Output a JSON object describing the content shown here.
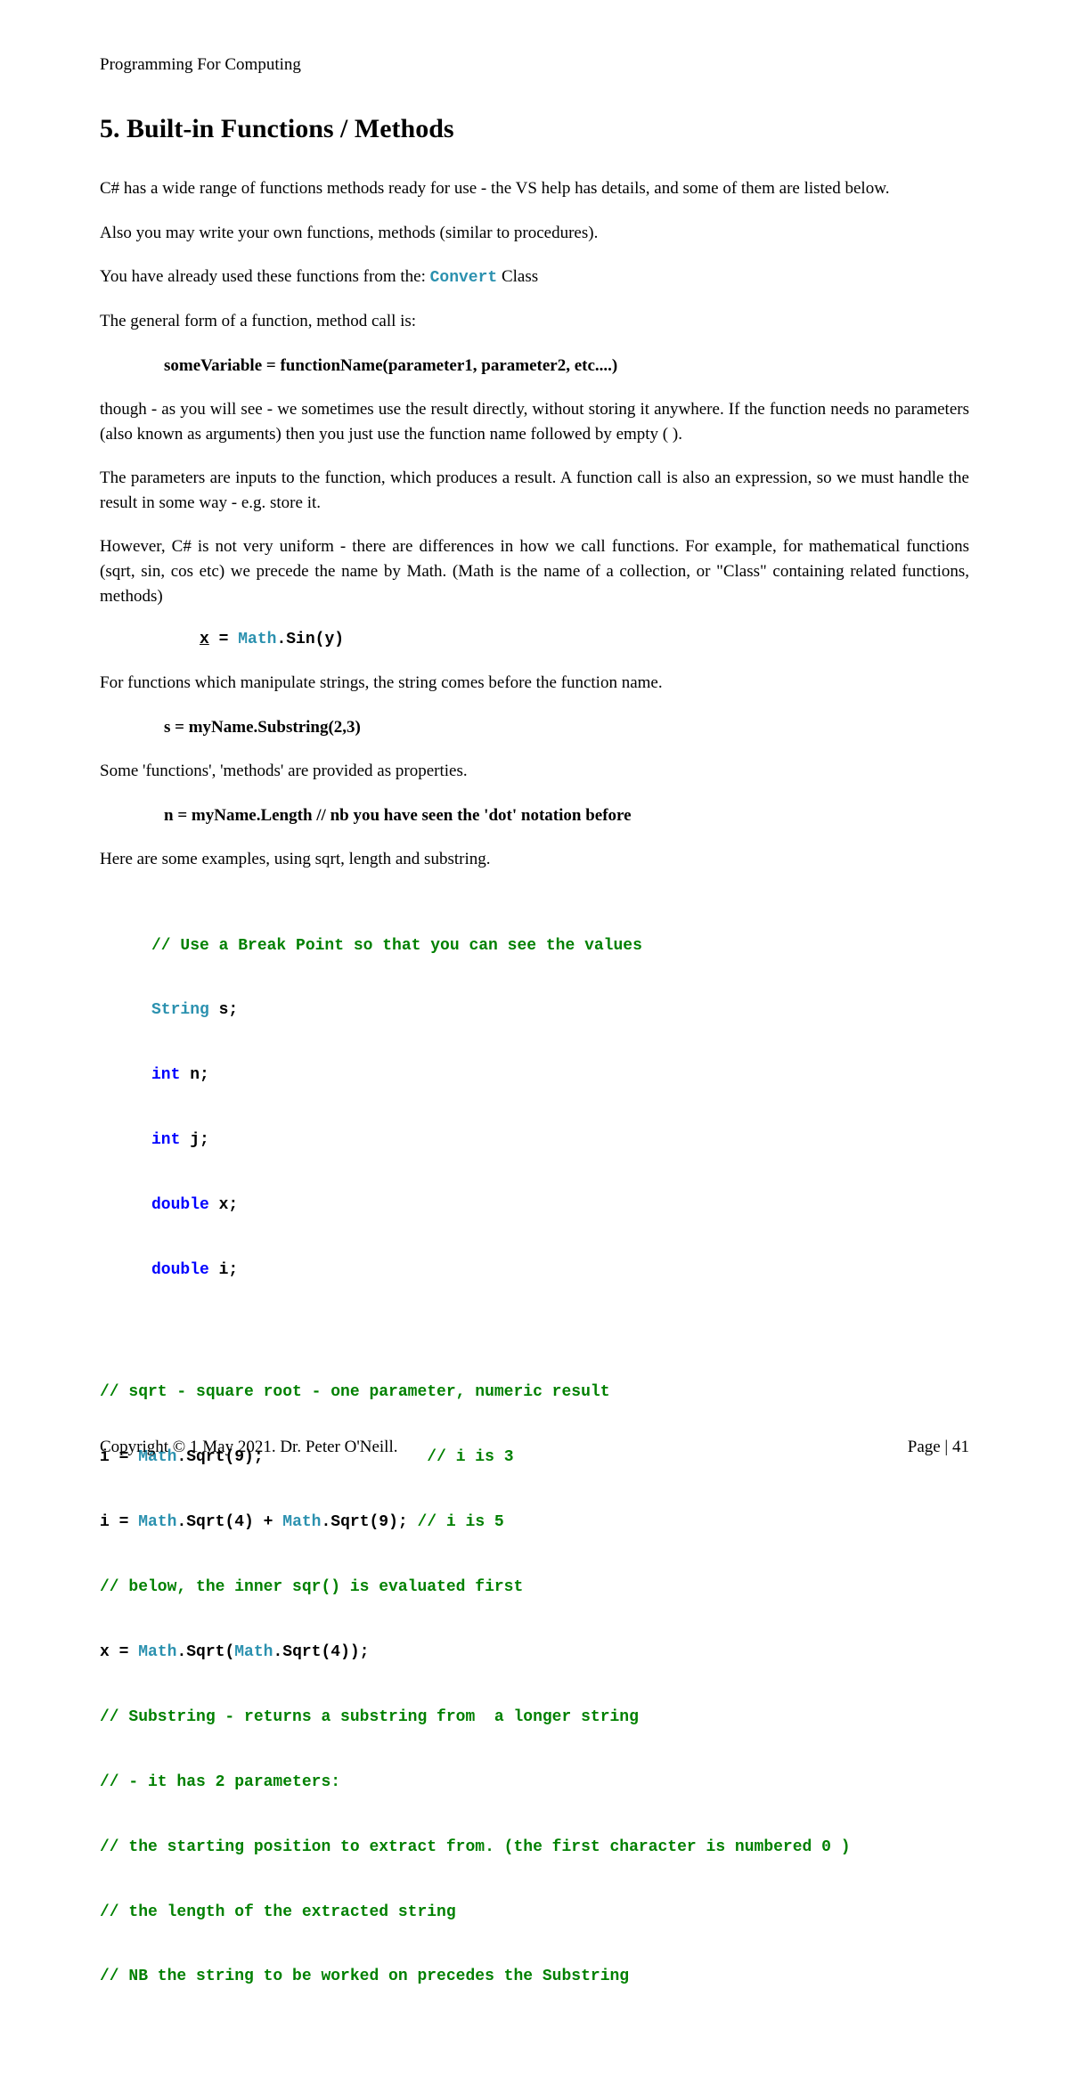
{
  "header": "Programming For Computing",
  "title": "5.  Built-in Functions / Methods",
  "para1": "C# has a wide range of functions methods ready for use - the VS help has details, and some of them are listed below.",
  "para2": "Also you may write your own functions, methods (similar to procedures).",
  "para3a": "You have already used these functions from the: ",
  "convert": "Convert",
  "para3b": " Class",
  "para4": "The general form of a function, method call is:",
  "formula1": "someVariable  =  functionName(parameter1, parameter2,   etc....)",
  "para5": "though - as you will see - we sometimes use the result directly, without storing it anywhere. If the function needs no parameters (also known as arguments) then you just use the function name followed by empty ( ).",
  "para6": "The parameters are inputs to the function, which produces a result. A function call is also an expression, so we must handle the result in some way - e.g. store it.",
  "para7": "However, C# is not very uniform - there are differences in how we call functions. For example, for mathematical functions (sqrt, sin, cos etc) we precede the name by Math. (Math is the name of a collection, or \"Class\" containing related functions, methods)",
  "para8": "For functions which manipulate strings, the string comes before the function name.",
  "formula2": "s = myName.Substring(2,3)",
  "para9": "Some 'functions', 'methods' are provided as properties.",
  "formula3": "n = myName.Length       // nb you have seen the 'dot' notation before",
  "para10": "Here are some examples, using sqrt, length and substring.",
  "code": {
    "c1": "// Use a Break Point so that you can see the values",
    "c2a": "String",
    "c2b": " s;",
    "c3a": "int",
    "c3b": " n;",
    "c4a": "int",
    "c4b": " j;",
    "c5a": "double",
    "c5b": " x;",
    "c6a": "double",
    "c6b": " i;",
    "c7": "// sqrt - square root - one parameter, numeric result",
    "c8a": "i = ",
    "c8b": "Math",
    "c8c": ".Sqrt(9);                 ",
    "c8d": "// i is 3",
    "c9a": "i = ",
    "c9b": "Math",
    "c9c": ".Sqrt(4) + ",
    "c9d": "Math",
    "c9e": ".Sqrt(9); ",
    "c9f": "// i is 5",
    "c10": "// below, the inner sqr() is evaluated first",
    "c11a": "x = ",
    "c11b": "Math",
    "c11c": ".Sqrt(",
    "c11d": "Math",
    "c11e": ".Sqrt(4));",
    "c12": "// Substring - returns a substring from  a longer string",
    "c13": "// - it has 2 parameters:",
    "c14": "// the starting position to extract from. (the first character is numbered 0 )",
    "c15": "// the length of the extracted string",
    "c16": "// NB the string to be worked on precedes the Substring"
  },
  "mathsin": {
    "x": "x",
    "eq": " = ",
    "math": "Math",
    "sin": ".Sin(y)"
  },
  "footer_left": "Copyright © 1 May 2021. Dr. Peter O'Neill.",
  "footer_right": "Page | 41"
}
